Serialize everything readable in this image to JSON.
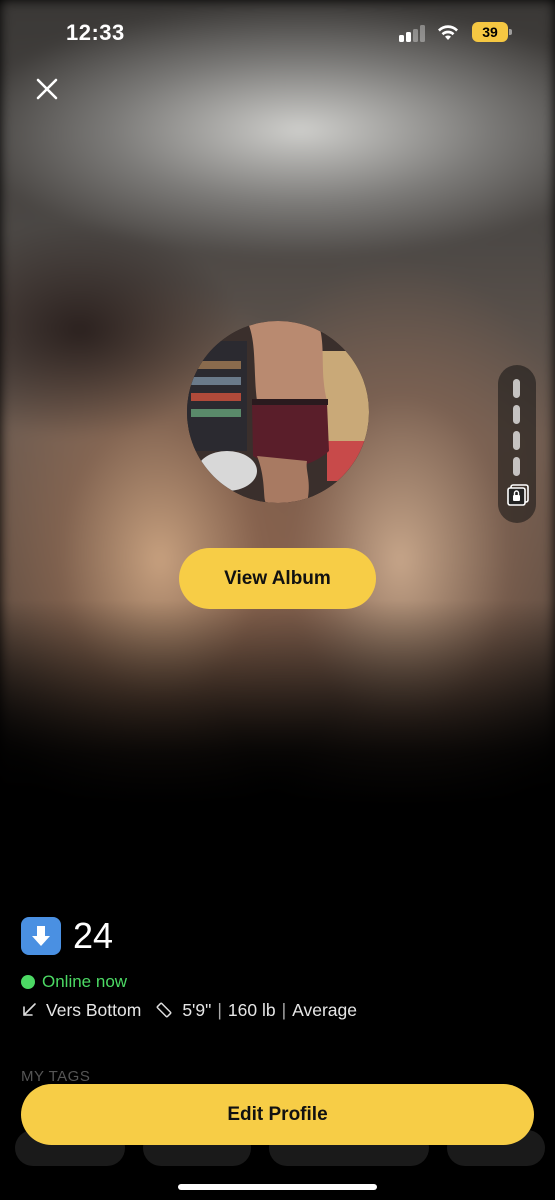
{
  "status_bar": {
    "time": "12:33",
    "battery_level": "39"
  },
  "photo": {
    "view_album_label": "View Album"
  },
  "profile": {
    "age_emoji": "⬇️",
    "age": "24",
    "online_status": "Online now",
    "position": "Vers Bottom",
    "height": "5'9\"",
    "weight": "160 lb",
    "body_type": "Average",
    "separator": "|"
  },
  "tags": {
    "section_label": "MY TAGS"
  },
  "actions": {
    "edit_profile_label": "Edit Profile"
  },
  "colors": {
    "accent": "#f7cd46",
    "online": "#4cd964",
    "background": "#000000"
  }
}
